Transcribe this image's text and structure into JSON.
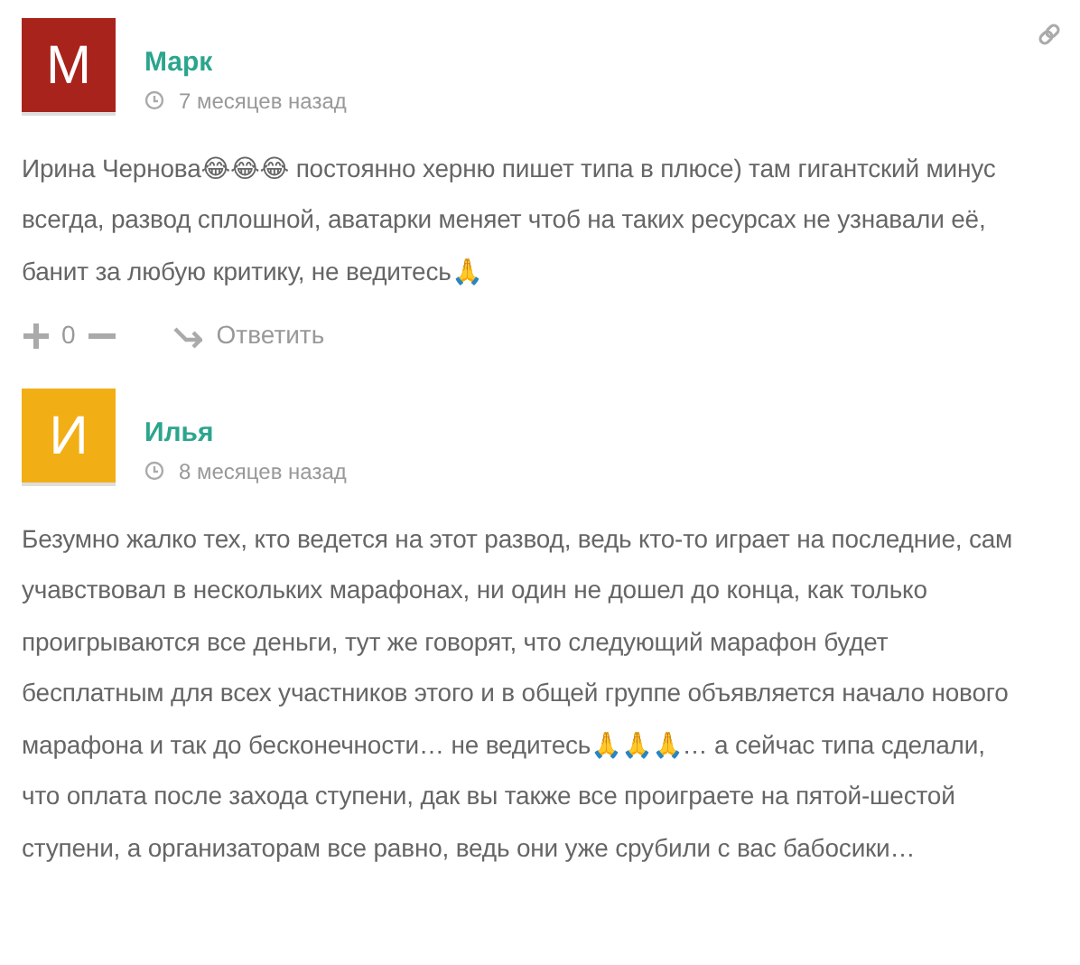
{
  "comments": [
    {
      "avatar": "М",
      "color": "#a8231c",
      "author": "Марк",
      "time": "7 месяцев назад",
      "permalink": true,
      "text": "Ирина Чернова😂😂😂 постоянно херню пишет типа в плюсе) там гигантский минус всегда, развод сплошной, аватарки меняет чтоб на таких ресурсах не узнавали её, банит за любую критику, не ведитесь🙏",
      "votes": {
        "score": "0"
      },
      "reply": "Ответить"
    },
    {
      "avatar": "И",
      "color": "#f2ae15",
      "author": "Илья",
      "time": "8 месяцев назад",
      "permalink": false,
      "text": "Безумно жалко тех, кто ведется на этот развод, ведь кто-то играет на последние, сам учавствовал в нескольких марафонах, ни один не дошел до конца, как только проигрываются все деньги, тут же говорят, что следующий марафон будет бесплатным для всех участников этого и в общей группе объявляется начало нового марафона и так до бесконечности… не ведитесь🙏🙏🙏… а сейчас типа сделали, что оплата после захода ступени, дак вы также все проиграете на пятой-шестой ступени, а организаторам все равно, ведь они уже срубили с вас бабосики…"
    }
  ]
}
